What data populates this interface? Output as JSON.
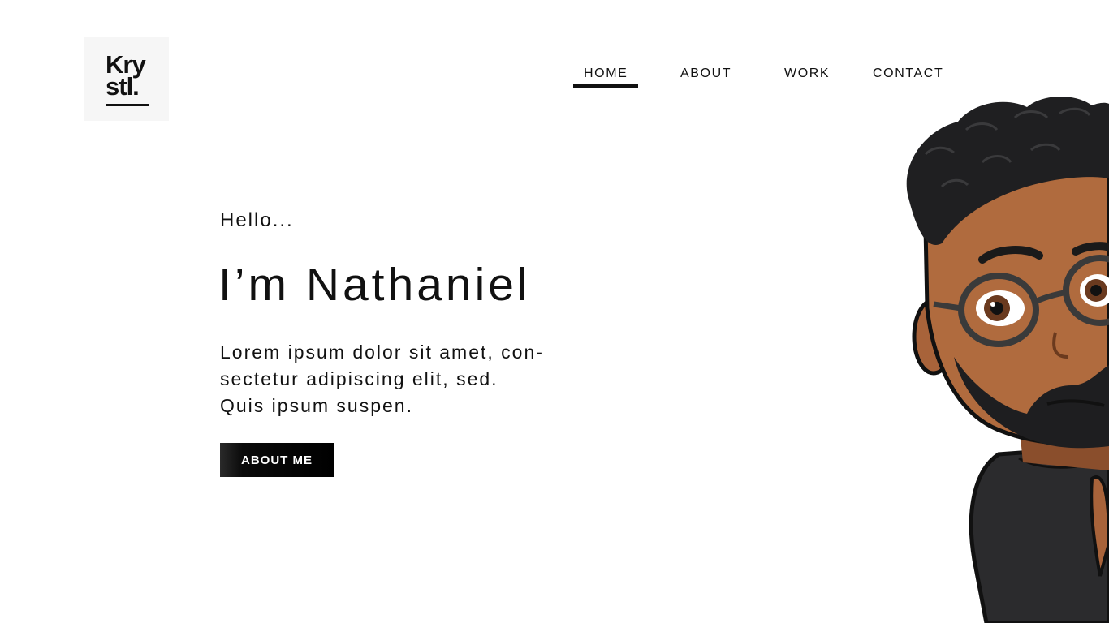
{
  "logo": {
    "line1": "Kry",
    "line2": "stl."
  },
  "nav": {
    "items": [
      {
        "label": "HOME",
        "active": true
      },
      {
        "label": "ABOUT",
        "active": false
      },
      {
        "label": "WORK",
        "active": false
      },
      {
        "label": "CONTACT",
        "active": false
      }
    ]
  },
  "hero": {
    "greeting": "Hello...",
    "headline": "I’m Nathaniel",
    "intro_lines": [
      "Lorem ipsum dolor sit amet, con-",
      "sectetur adipiscing elit, sed.",
      "Quis ipsum suspen."
    ],
    "cta_label": "ABOUT ME"
  },
  "illustration": {
    "icon": "bitmoji-avatar-icon"
  },
  "colors": {
    "text": "#111111",
    "accent": "#000000",
    "logo_bg": "#f6f6f6",
    "background": "#ffffff"
  }
}
